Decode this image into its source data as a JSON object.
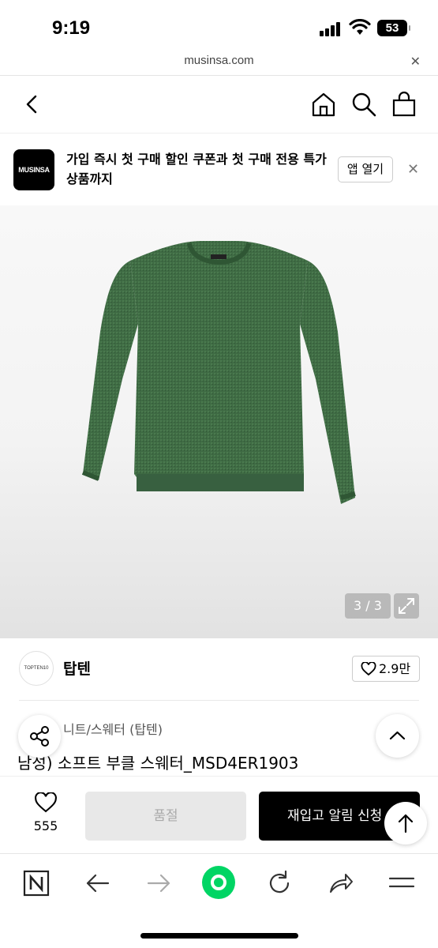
{
  "status_bar": {
    "time": "9:19",
    "battery": "53"
  },
  "url_bar": {
    "domain": "musinsa.com",
    "close_icon": "close-icon"
  },
  "nav": {
    "back_icon": "chevron-left-icon",
    "home_icon": "home-icon",
    "search_icon": "search-icon",
    "cart_icon": "shopping-bag-icon"
  },
  "banner": {
    "logo_text": "MUSINSA",
    "message": "가입 즉시 첫 구매 할인 쿠폰과 첫 구매 전용 특가 상품까지",
    "open_app_label": "앱 열기"
  },
  "product": {
    "image_counter": "3 / 3",
    "brand_logo_text": "TOPTEN10",
    "brand_name": "탑텐",
    "likes": "2.9만",
    "category": "니트/스웨터 (탑텐)",
    "title": "남성) 소프트 부클 스웨터_MSD4ER1903",
    "sweater_color": "#3f6b44"
  },
  "purchase_bar": {
    "wish_count": "555",
    "soldout_label": "품절",
    "restock_label": "재입고 알림 신청"
  },
  "browser_toolbar": {
    "tabs_icon": "n-tab-icon",
    "back_icon": "arrow-left-icon",
    "forward_icon": "arrow-right-icon",
    "green_dot_icon": "green-dot-icon",
    "reload_icon": "reload-icon",
    "share_icon": "share-icon",
    "menu_icon": "menu-icon",
    "accent": "#00d564"
  }
}
